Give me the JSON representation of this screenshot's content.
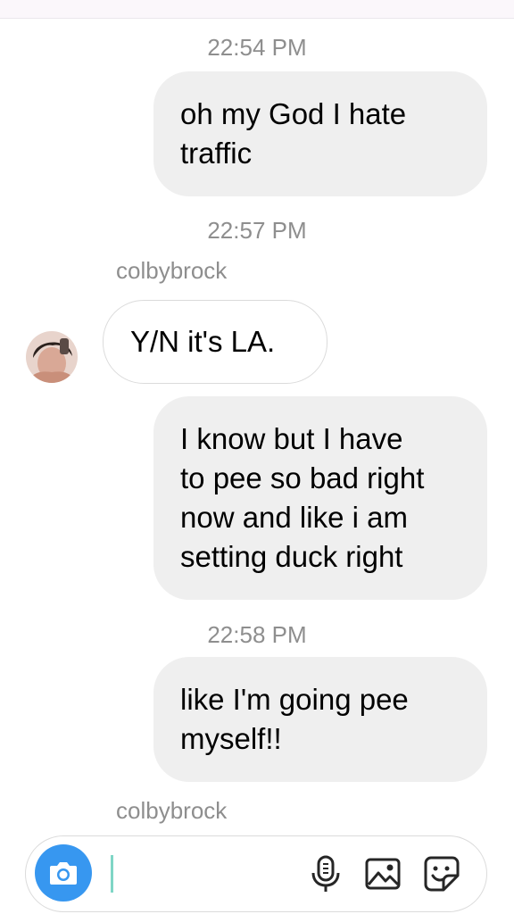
{
  "thread": {
    "messages": [
      {
        "type": "timestamp",
        "text": "22:54 PM"
      },
      {
        "type": "outgoing",
        "text": "oh my God I hate\ntraffic"
      },
      {
        "type": "timestamp",
        "text": "22:57 PM"
      },
      {
        "type": "sender",
        "text": "colbybrock"
      },
      {
        "type": "incoming",
        "text": "Y/N it's LA."
      },
      {
        "type": "outgoing",
        "text": "I know but I have\nto pee so bad right\nnow and like i am\nsetting duck right"
      },
      {
        "type": "timestamp",
        "text": "22:58 PM"
      },
      {
        "type": "outgoing",
        "text": "like I'm going pee\nmyself!!"
      },
      {
        "type": "sender",
        "text": "colbybrock"
      }
    ]
  },
  "composer": {
    "value": "",
    "icons": [
      "camera-icon",
      "microphone-icon",
      "gallery-icon",
      "sticker-icon"
    ]
  },
  "colors": {
    "accent": "#3797f0",
    "outgoing_bubble": "#efefef",
    "meta_text": "#8e8e8e"
  }
}
